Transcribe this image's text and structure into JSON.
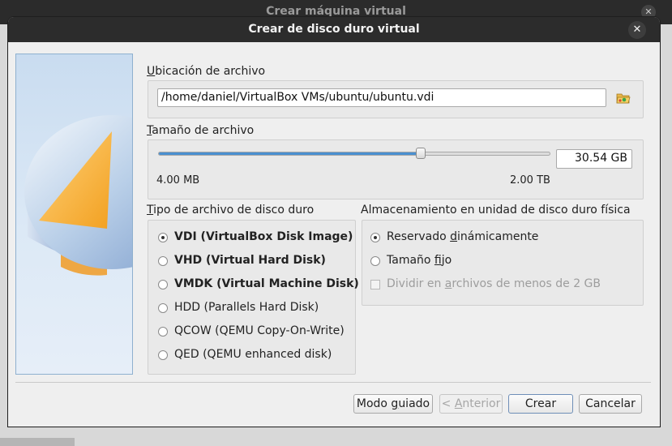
{
  "background_window": {
    "title": "Crear máquina virtual",
    "close_glyph": "✕"
  },
  "dialog": {
    "title": "Crear de disco duro virtual",
    "close_glyph": "✕"
  },
  "file_location": {
    "label_first": "U",
    "label_rest": "bicación de archivo",
    "path": "/home/daniel/VirtualBox VMs/ubuntu/ubuntu.vdi",
    "folder_icon": "folder-open-icon"
  },
  "file_size": {
    "label_first": "T",
    "label_rest": "amaño de archivo",
    "value": "30.54 GB",
    "min_label": "4.00 MB",
    "max_label": "2.00 TB",
    "slider_fraction": 0.67
  },
  "disk_type": {
    "label_first": "T",
    "label_rest": "ipo de archivo de disco duro",
    "options": [
      {
        "label": "VDI (VirtualBox Disk Image)",
        "selected": true,
        "bold": true
      },
      {
        "label": "VHD (Virtual Hard Disk)",
        "selected": false,
        "bold": true
      },
      {
        "label": "VMDK (Virtual Machine Disk)",
        "selected": false,
        "bold": true
      },
      {
        "label": "HDD (Parallels Hard Disk)",
        "selected": false,
        "bold": false
      },
      {
        "label": "QCOW (QEMU Copy-On-Write)",
        "selected": false,
        "bold": false
      },
      {
        "label": "QED (QEMU enhanced disk)",
        "selected": false,
        "bold": false
      }
    ]
  },
  "storage": {
    "label": "Almacenamiento en unidad de disco duro física",
    "dynamic": {
      "pre": "Reservado ",
      "u": "d",
      "post": "inámicamente",
      "selected": true
    },
    "fixed": {
      "pre": "Tamaño ",
      "u": "f",
      "post": "ijo",
      "selected": false
    },
    "split": {
      "pre": "Dividir en ",
      "u": "a",
      "post": "rchivos de menos de 2 GB",
      "checked": false,
      "enabled": false
    }
  },
  "buttons": {
    "guided": {
      "pre": "Modo ",
      "u": "g",
      "post": "uiado"
    },
    "back": {
      "pre": "< ",
      "u": "A",
      "post": "nterior"
    },
    "create": "Crear",
    "cancel": "Cancelar"
  },
  "colors": {
    "accent": "#4a90d0",
    "titlebar": "#2c2c2c",
    "dialog_bg": "#efefef"
  }
}
